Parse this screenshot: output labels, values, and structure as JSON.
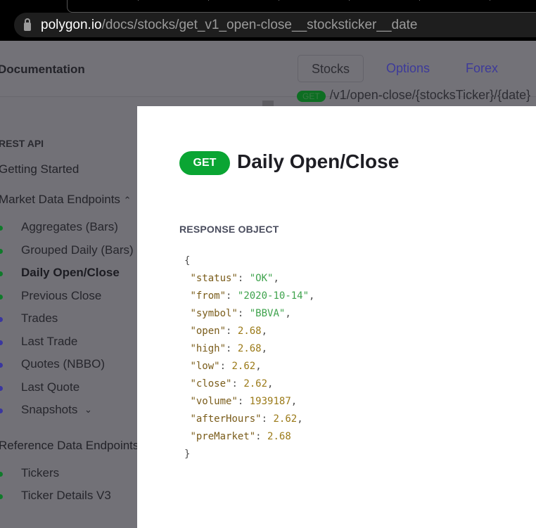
{
  "browser": {
    "url_host": "polygon.io",
    "url_path": "/docs/stocks/get_v1_open-close__stocksticker__date"
  },
  "header": {
    "title": "Documentation",
    "tabs": [
      "Stocks",
      "Options",
      "Forex"
    ],
    "active_tab": "Stocks"
  },
  "behind": {
    "method": "GET",
    "path": "/v1/open-close/{stocksTicker}/{date}"
  },
  "sidebar": {
    "section": "REST API",
    "getting_started": "Getting Started",
    "market_group": "Market Data Endpoints",
    "market_items": [
      {
        "label": "Aggregates (Bars)",
        "color": "#0f7a2a"
      },
      {
        "label": "Grouped Daily (Bars)",
        "color": "#0f7a2a"
      },
      {
        "label": "Daily Open/Close",
        "color": "#0f7a2a",
        "active": true
      },
      {
        "label": "Previous Close",
        "color": "#0f7a2a"
      },
      {
        "label": "Trades",
        "color": "#3a36a0"
      },
      {
        "label": "Last Trade",
        "color": "#3a36a0"
      },
      {
        "label": "Quotes (NBBO)",
        "color": "#3a36a0"
      },
      {
        "label": "Last Quote",
        "color": "#3a36a0"
      },
      {
        "label": "Snapshots",
        "color": "#3a36a0"
      }
    ],
    "reference_group": "Reference Data Endpoints",
    "reference_items": [
      {
        "label": "Tickers",
        "color": "#0f7a2a"
      },
      {
        "label": "Ticker Details V3",
        "color": "#0f7a2a"
      }
    ]
  },
  "modal": {
    "method": "GET",
    "title": "Daily Open/Close",
    "section": "RESPONSE OBJECT",
    "response": [
      {
        "key": "status",
        "value": "\"OK\"",
        "type": "s"
      },
      {
        "key": "from",
        "value": "\"2020-10-14\"",
        "type": "s"
      },
      {
        "key": "symbol",
        "value": "\"BBVA\"",
        "type": "s"
      },
      {
        "key": "open",
        "value": "2.68",
        "type": "n"
      },
      {
        "key": "high",
        "value": "2.68",
        "type": "n"
      },
      {
        "key": "low",
        "value": "2.62",
        "type": "n"
      },
      {
        "key": "close",
        "value": "2.62",
        "type": "n"
      },
      {
        "key": "volume",
        "value": "1939187",
        "type": "n"
      },
      {
        "key": "afterHours",
        "value": "2.62",
        "type": "n"
      },
      {
        "key": "preMarket",
        "value": "2.68",
        "type": "n"
      }
    ]
  }
}
